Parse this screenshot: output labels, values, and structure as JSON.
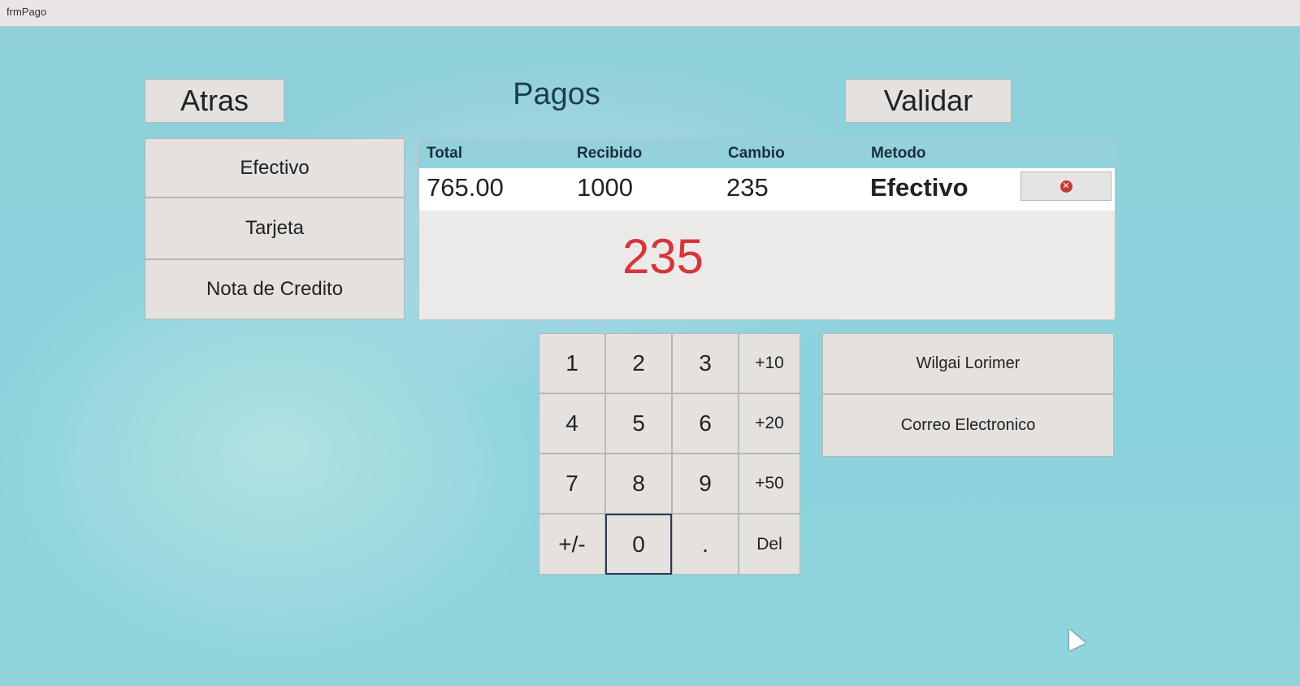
{
  "window": {
    "title": "frmPago"
  },
  "header": {
    "back_label": "Atras",
    "title": "Pagos",
    "validate_label": "Validar"
  },
  "methods": [
    "Efectivo",
    "Tarjeta",
    "Nota de Credito"
  ],
  "payments": {
    "headers": {
      "total": "Total",
      "received": "Recibido",
      "change": "Cambio",
      "method": "Metodo"
    },
    "row": {
      "total": "765.00",
      "received": "1000",
      "change": "235",
      "method": "Efectivo"
    },
    "remove_icon": "x-circle-icon"
  },
  "change_display": "235",
  "keypad": {
    "keys": [
      "1",
      "2",
      "3",
      "+10",
      "4",
      "5",
      "6",
      "+20",
      "7",
      "8",
      "9",
      "+50",
      "+/-",
      "0",
      ".",
      "Del"
    ]
  },
  "customer": {
    "name": "Wilgai Lorimer",
    "email_label": "Correo Electronico"
  },
  "colors": {
    "change_value": "#d6353c",
    "background": "#87cfd8"
  }
}
